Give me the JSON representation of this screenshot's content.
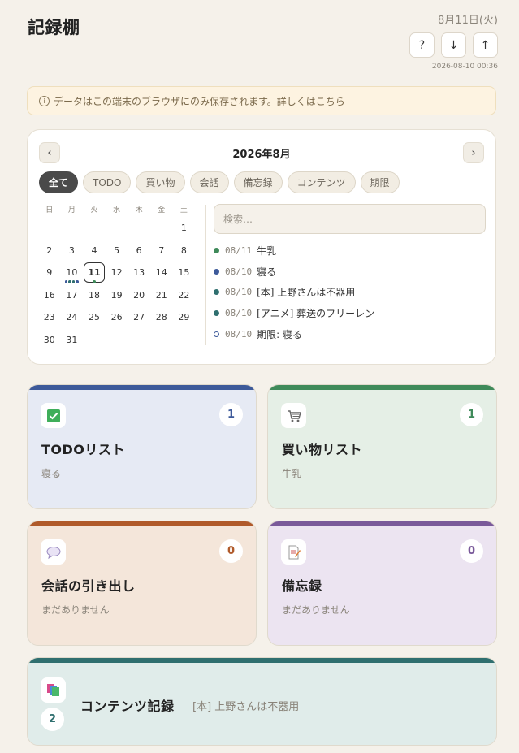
{
  "header": {
    "title": "記録棚",
    "date": "8月11日(火)",
    "help_label": "?",
    "download_label": "↓",
    "upload_label": "↑",
    "saved_at": "2026-08-10 00:36"
  },
  "notice": {
    "icon": "info-icon",
    "icon_glyph": "i",
    "text": "データはこの端末のブラウザにのみ保存されます。詳しくはこちら"
  },
  "calendar": {
    "month_label": "2026年8月",
    "prev_label": "‹",
    "next_label": "›",
    "filters": [
      "全て",
      "TODO",
      "買い物",
      "会話",
      "備忘録",
      "コンテンツ",
      "期限"
    ],
    "active_filter": "全て",
    "weekdays": [
      "日",
      "月",
      "火",
      "水",
      "木",
      "金",
      "土"
    ],
    "weeks": [
      [
        "",
        "",
        "",
        "",
        "",
        "",
        "1"
      ],
      [
        "2",
        "3",
        "4",
        "5",
        "6",
        "7",
        "8"
      ],
      [
        "9",
        "10",
        "11",
        "12",
        "13",
        "14",
        "15"
      ],
      [
        "16",
        "17",
        "18",
        "19",
        "20",
        "21",
        "22"
      ],
      [
        "23",
        "24",
        "25",
        "26",
        "27",
        "28",
        "29"
      ],
      [
        "30",
        "31",
        "",
        "",
        "",
        "",
        ""
      ]
    ],
    "today": "11",
    "day_markers": {
      "10": [
        "#3d5a9a",
        "#2f6f6f",
        "#2f6f6f",
        "#3d5a9a"
      ],
      "11": [
        "#3f8a5a"
      ]
    },
    "search_placeholder": "検索…",
    "events": [
      {
        "date": "08/11",
        "text": "牛乳",
        "color": "#3f8a5a",
        "hollow": false
      },
      {
        "date": "08/10",
        "text": "寝る",
        "color": "#3d5a9a",
        "hollow": false
      },
      {
        "date": "08/10",
        "text": "[本] 上野さんは不器用",
        "color": "#2f6f6f",
        "hollow": false
      },
      {
        "date": "08/10",
        "text": "[アニメ] 葬送のフリーレン",
        "color": "#2f6f6f",
        "hollow": false
      },
      {
        "date": "08/10",
        "text": "期限: 寝る",
        "color": "#3d5a9a",
        "hollow": true
      }
    ]
  },
  "cards": {
    "todo": {
      "title": "TODOリスト",
      "count": "1",
      "sub": "寝る",
      "icon": "checkbox-icon",
      "bg": "#e6eaf4",
      "bar": "#3d5a9a",
      "countColor": "#3d5a9a"
    },
    "shopping": {
      "title": "買い物リスト",
      "count": "1",
      "sub": "牛乳",
      "icon": "shopping-cart-icon",
      "bg": "#e5efe6",
      "bar": "#3f8a5a",
      "countColor": "#3f8a5a"
    },
    "conversation": {
      "title": "会話の引き出し",
      "count": "0",
      "sub": "まだありません",
      "icon": "speech-bubble-icon",
      "bg": "#f4e6da",
      "bar": "#b05a2a",
      "countColor": "#b05a2a"
    },
    "memo": {
      "title": "備忘録",
      "count": "0",
      "sub": "まだありません",
      "icon": "memo-icon",
      "bg": "#ece4f1",
      "bar": "#7a5a9a",
      "countColor": "#7a5a9a"
    },
    "contents": {
      "title": "コンテンツ記録",
      "count": "2",
      "sub": "[本] 上野さんは不器用",
      "icon": "books-icon",
      "bg": "#e0ecea",
      "bar": "#2f6f6f",
      "countColor": "#2f6f6f"
    }
  }
}
